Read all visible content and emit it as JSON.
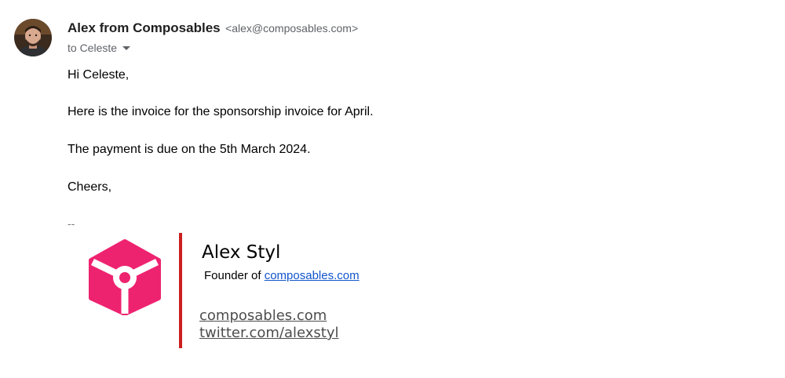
{
  "header": {
    "sender_name": "Alex from Composables",
    "sender_email": "<alex@composables.com>",
    "recipient": "to Celeste"
  },
  "body": {
    "greeting": "Hi Celeste,",
    "line1": "Here is the invoice for the sponsorship invoice for April.",
    "line2": "The payment is due on the 5th March 2024.",
    "signoff": "Cheers,",
    "separator": "--"
  },
  "signature": {
    "name": "Alex Styl",
    "title_prefix": "Founder of ",
    "title_link": "composables.com",
    "link1": "composables.com",
    "link2": "twitter.com/alexstyl"
  },
  "colors": {
    "logo_pink": "#ee2370",
    "signature_rule": "#cc1f1f",
    "link_blue": "#1155cc"
  },
  "icons": {
    "avatar": "sender-avatar",
    "caret": "chevron-down-icon",
    "logo": "composables-logo"
  }
}
